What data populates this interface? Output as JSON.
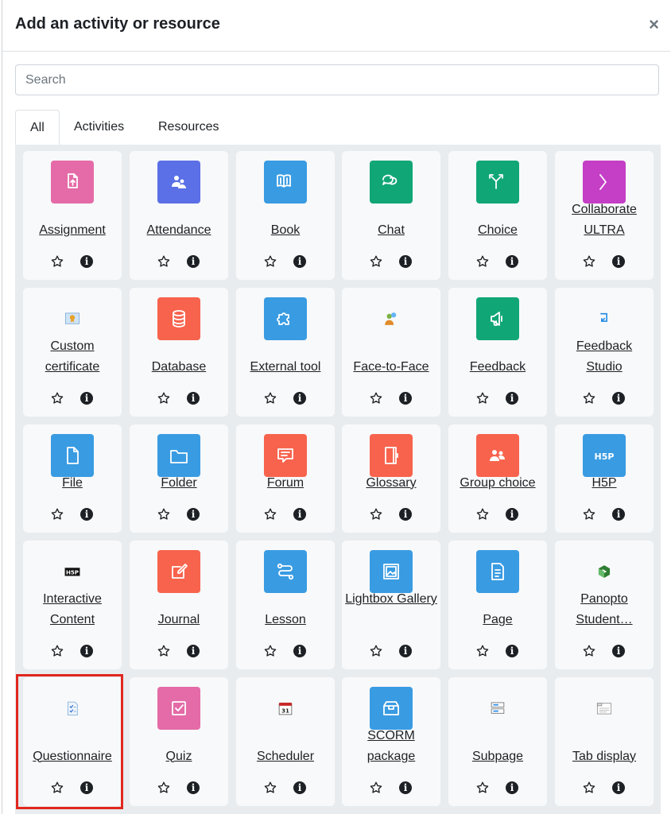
{
  "modal": {
    "title": "Add an activity or resource",
    "close_label": "×",
    "search_placeholder": "Search"
  },
  "tabs": [
    {
      "label": "All",
      "active": true
    },
    {
      "label": "Activities",
      "active": false
    },
    {
      "label": "Resources",
      "active": false
    }
  ],
  "items": [
    {
      "name": "Assignment",
      "icon": "assignment-icon",
      "color": "#e46ba7"
    },
    {
      "name": "Attendance",
      "icon": "attendance-icon",
      "color": "#5b6fe6"
    },
    {
      "name": "Book",
      "icon": "book-icon",
      "color": "#399be2"
    },
    {
      "name": "Chat",
      "icon": "chat-icon",
      "color": "#11a676"
    },
    {
      "name": "Choice",
      "icon": "choice-icon",
      "color": "#11a676"
    },
    {
      "name": "Collaborate ULTRA",
      "icon": "collaborate-icon",
      "color": "#c43ec6"
    },
    {
      "name": "Custom certificate",
      "icon": "certificate-icon",
      "color": ""
    },
    {
      "name": "Database",
      "icon": "database-icon",
      "color": "#f7634d"
    },
    {
      "name": "External tool",
      "icon": "puzzle-icon",
      "color": "#399be2"
    },
    {
      "name": "Face-to-Face",
      "icon": "face-to-face-icon",
      "color": ""
    },
    {
      "name": "Feedback",
      "icon": "megaphone-icon",
      "color": "#11a676"
    },
    {
      "name": "Feedback Studio",
      "icon": "feedback-studio-icon",
      "color": ""
    },
    {
      "name": "File",
      "icon": "file-icon",
      "color": "#399be2"
    },
    {
      "name": "Folder",
      "icon": "folder-icon",
      "color": "#399be2"
    },
    {
      "name": "Forum",
      "icon": "forum-icon",
      "color": "#f7634d"
    },
    {
      "name": "Glossary",
      "icon": "glossary-icon",
      "color": "#f7634d"
    },
    {
      "name": "Group choice",
      "icon": "group-choice-icon",
      "color": "#f7634d"
    },
    {
      "name": "H5P",
      "icon": "h5p-icon",
      "color": "#399be2"
    },
    {
      "name": "Interactive Content",
      "icon": "h5p-black-icon",
      "color": ""
    },
    {
      "name": "Journal",
      "icon": "journal-icon",
      "color": "#f7634d"
    },
    {
      "name": "Lesson",
      "icon": "lesson-icon",
      "color": "#399be2"
    },
    {
      "name": "Lightbox Gallery",
      "icon": "gallery-icon",
      "color": "#399be2"
    },
    {
      "name": "Page",
      "icon": "page-icon",
      "color": "#399be2"
    },
    {
      "name": "Panopto Student…",
      "icon": "panopto-icon",
      "color": ""
    },
    {
      "name": "Questionnaire",
      "icon": "questionnaire-icon",
      "color": ""
    },
    {
      "name": "Quiz",
      "icon": "quiz-icon",
      "color": "#e46ba7"
    },
    {
      "name": "Scheduler",
      "icon": "calendar-icon",
      "color": ""
    },
    {
      "name": "SCORM package",
      "icon": "scorm-icon",
      "color": "#399be2"
    },
    {
      "name": "Subpage",
      "icon": "subpage-icon",
      "color": ""
    },
    {
      "name": "Tab display",
      "icon": "tab-display-icon",
      "color": ""
    }
  ],
  "highlighted_item": "Questionnaire"
}
